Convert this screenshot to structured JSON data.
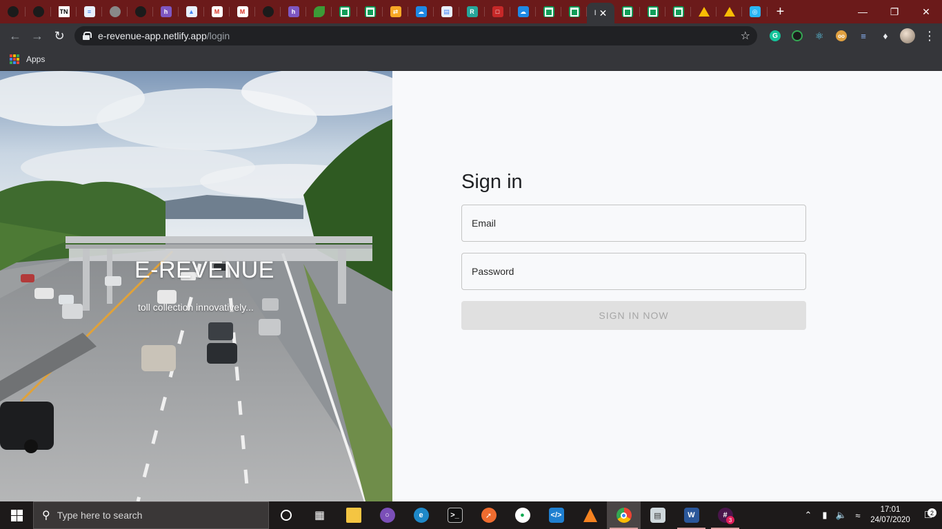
{
  "browser": {
    "tabs": [
      {
        "icon": "github-icon",
        "cls": "github",
        "glyph": ""
      },
      {
        "icon": "github-icon",
        "cls": "github",
        "glyph": ""
      },
      {
        "icon": "tn-icon",
        "cls": "tn",
        "glyph": "TN"
      },
      {
        "icon": "document-icon",
        "cls": "doc",
        "glyph": "≡"
      },
      {
        "icon": "globe-icon",
        "cls": "gray",
        "glyph": ""
      },
      {
        "icon": "github-icon",
        "cls": "github",
        "glyph": ""
      },
      {
        "icon": "h-icon",
        "cls": "h",
        "glyph": "h"
      },
      {
        "icon": "building-icon",
        "cls": "doc",
        "glyph": "▲"
      },
      {
        "icon": "gmail-icon",
        "cls": "gmail",
        "glyph": "M"
      },
      {
        "icon": "gmail-icon",
        "cls": "gmail",
        "glyph": "M"
      },
      {
        "icon": "github-icon",
        "cls": "github",
        "glyph": ""
      },
      {
        "icon": "h-icon",
        "cls": "h",
        "glyph": "h"
      },
      {
        "icon": "leaf-icon",
        "cls": "green",
        "glyph": ""
      },
      {
        "icon": "sheets-icon",
        "cls": "sheet",
        "glyph": ""
      },
      {
        "icon": "sheets-icon",
        "cls": "sheet",
        "glyph": ""
      },
      {
        "icon": "swap-icon",
        "cls": "orange",
        "glyph": "⇄"
      },
      {
        "icon": "cloud-icon",
        "cls": "blue",
        "glyph": "☁"
      },
      {
        "icon": "file-icon",
        "cls": "doc",
        "glyph": "▤"
      },
      {
        "icon": "r-icon",
        "cls": "teal",
        "glyph": "R"
      },
      {
        "icon": "chat-icon",
        "cls": "red",
        "glyph": "□"
      },
      {
        "icon": "cloud-icon",
        "cls": "blue",
        "glyph": "☁"
      },
      {
        "icon": "sheets-icon",
        "cls": "sheet",
        "glyph": ""
      },
      {
        "icon": "sheets-icon",
        "cls": "sheet",
        "glyph": ""
      }
    ],
    "tabs_after": [
      {
        "icon": "sheets-icon",
        "cls": "sheet",
        "glyph": ""
      },
      {
        "icon": "sheets-icon",
        "cls": "sheet",
        "glyph": ""
      },
      {
        "icon": "sheets-icon",
        "cls": "sheet",
        "glyph": ""
      },
      {
        "icon": "drive-icon",
        "cls": "drive",
        "glyph": ""
      },
      {
        "icon": "drive-icon",
        "cls": "drive",
        "glyph": ""
      },
      {
        "icon": "globe-icon",
        "cls": "lblue",
        "glyph": "◎"
      }
    ],
    "active_tab_glyph": "I",
    "close_glyph": "✕",
    "new_tab_glyph": "+",
    "url_host": "e-revenue-app.netlify.app",
    "url_path": "/login",
    "bookmarks_apps": "Apps"
  },
  "page": {
    "hero_title": "E-REVENUE",
    "hero_subtitle": "toll collection innovatively...",
    "signin_heading": "Sign in",
    "email_label": "Email",
    "password_label": "Password",
    "signin_button": "SIGN IN NOW"
  },
  "taskbar": {
    "search_placeholder": "Type here to search",
    "time": "17:01",
    "date": "24/07/2020",
    "notification_count": "2",
    "slack_badge": "3"
  }
}
